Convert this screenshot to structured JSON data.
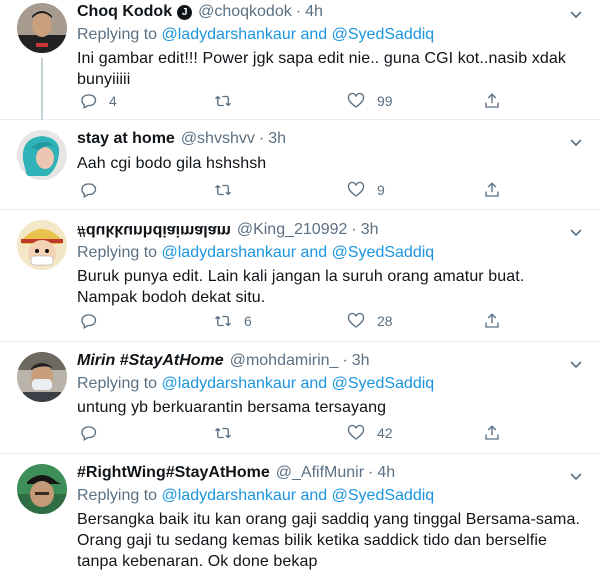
{
  "tweets": [
    {
      "name": "Choq Kodok",
      "verified_glyph": "J",
      "handle": "@choqkodok",
      "separator": "·",
      "time": "4h",
      "reply_prefix": "Replying to ",
      "reply_mention1": "@ladydarshankaur",
      "reply_and": " and ",
      "reply_mention2": "@SyedSaddiq",
      "text_lines": [
        "Ini gambar edit!!! Power jgk sapa edit nie.. guna CGI kot..nasib xdak",
        "bunyiiiii"
      ],
      "reply_count": "4",
      "retweet_count": "",
      "like_count": "99",
      "avatar_icon": "avatar-man-black-shirt"
    },
    {
      "name": "stay at home",
      "handle": "@shvshvv",
      "separator": "·",
      "time": "3h",
      "text_lines": [
        "Aah cgi bodo gila hshshsh"
      ],
      "reply_count": "",
      "retweet_count": "",
      "like_count": "9",
      "avatar_icon": "avatar-teal-hair"
    },
    {
      "name": "#dukkunhdiaimalam",
      "handle": "@King_210992",
      "separator": "·",
      "time": "3h",
      "reply_prefix": "Replying to ",
      "reply_mention1": "@ladydarshankaur",
      "reply_and": " and ",
      "reply_mention2": "@SyedSaddiq",
      "text_lines": [
        "Buruk punya edit. Lain kali jangan la suruh orang amatur buat.",
        "Nampak bodoh dekat situ."
      ],
      "reply_count": "",
      "retweet_count": "6",
      "like_count": "28",
      "avatar_icon": "avatar-anime-face"
    },
    {
      "name": "Mirin #StayAtHome",
      "handle": "@mohdamirin_",
      "separator": "·",
      "time": "3h",
      "reply_prefix": "Replying to ",
      "reply_mention1": "@ladydarshankaur",
      "reply_and": " and ",
      "reply_mention2": "@SyedSaddiq",
      "text_lines": [
        "untung yb berkuarantin bersama tersayang"
      ],
      "reply_count": "",
      "retweet_count": "",
      "like_count": "42",
      "avatar_icon": "avatar-masked-person"
    },
    {
      "name": "#RightWing#StayAtHome",
      "handle": "@_AfifMunir",
      "separator": "·",
      "time": "4h",
      "reply_prefix": "Replying to ",
      "reply_mention1": "@ladydarshankaur",
      "reply_and": " and ",
      "reply_mention2": "@SyedSaddiq",
      "text_lines": [
        "Bersangka baik itu kan orang gaji saddiq yang tinggal Bersama-sama.",
        "Orang gaji tu sedang kemas bilik ketika saddick tido dan berselfie",
        "tanpa kebenaran. Ok done bekap"
      ],
      "avatar_icon": "avatar-cap-person"
    }
  ],
  "colors": {
    "text": "#0f1419",
    "muted": "#5b7083",
    "mention": "#1b95e0",
    "divider": "#e6ecf0"
  },
  "icons": [
    "reply-icon",
    "retweet-icon",
    "like-icon",
    "share-icon",
    "chevron-down-icon",
    "verified-icon"
  ]
}
